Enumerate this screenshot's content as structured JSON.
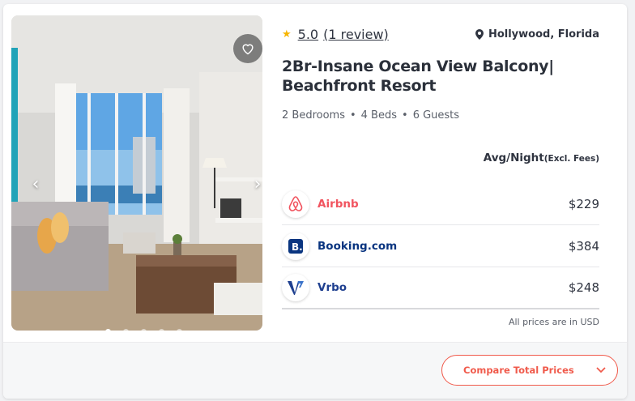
{
  "listing": {
    "rating": "5.0",
    "reviews": "(1 review)",
    "location": "Hollywood, Florida",
    "title": "2Br-Insane Ocean View Balcony| Beachfront Resort",
    "specs": [
      "2 Bedrooms",
      "4 Beds",
      "6 Guests"
    ]
  },
  "gallery": {
    "photo_count": 5,
    "active_index": 0
  },
  "pricing": {
    "header": "Avg/Night",
    "header_note": "(Excl. Fees)",
    "providers": [
      {
        "name": "Airbnb",
        "price": "$229",
        "color": "#f1545f",
        "icon": "airbnb-logo"
      },
      {
        "name": "Booking.com",
        "price": "$384",
        "color": "#0a3580",
        "icon": "booking-logo"
      },
      {
        "name": "Vrbo",
        "price": "$248",
        "color": "#1e3f8f",
        "icon": "vrbo-logo"
      }
    ],
    "currency_note": "All prices are in USD"
  },
  "footer": {
    "compare_label": "Compare Total Prices"
  },
  "colors": {
    "accent": "#f05a4b",
    "star": "#f7b500",
    "text": "#2f3440"
  }
}
